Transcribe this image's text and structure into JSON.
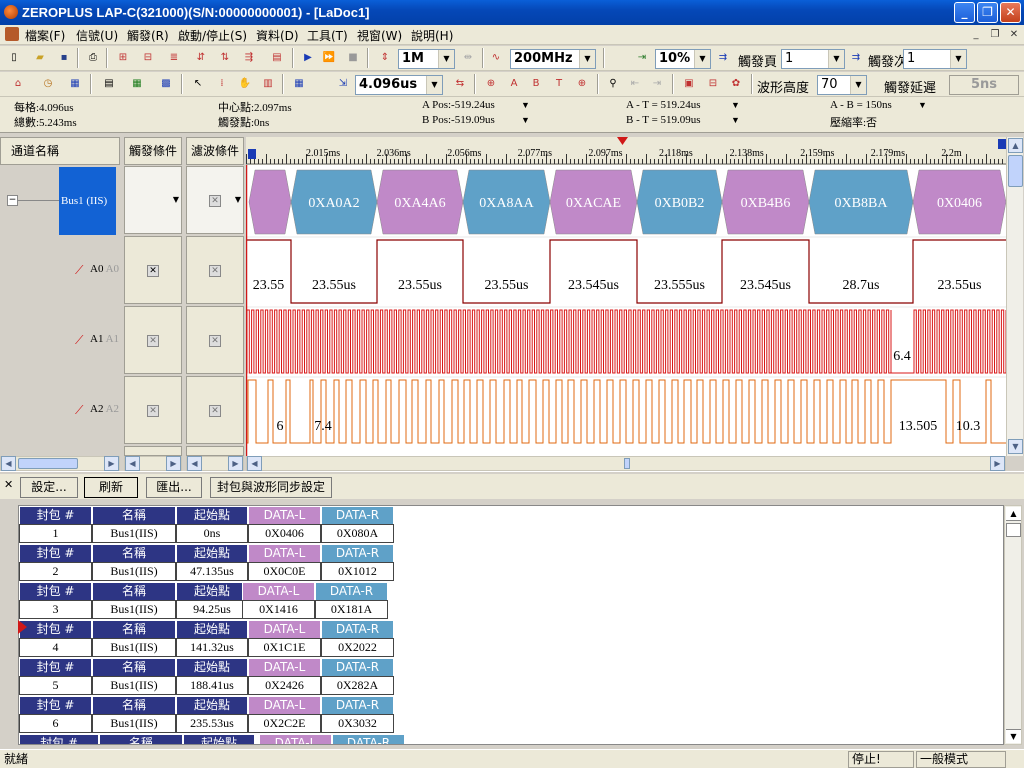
{
  "window": {
    "title": "ZEROPLUS LAP-C(321000)(S/N:00000000001) - [LaDoc1]",
    "min": "_",
    "max": "❐",
    "close": "✕"
  },
  "menu": [
    "檔案(F)",
    "信號(U)",
    "觸發(R)",
    "啟動/停止(S)",
    "資料(D)",
    "工具(T)",
    "視窗(W)",
    "說明(H)"
  ],
  "toolbar1": {
    "memory": "1M",
    "samplerate": "200MHz",
    "trigger_pos": "10%",
    "trigger_page_label": "觸發頁",
    "trigger_page": "1",
    "trigger_count_label": "觸發次數",
    "trigger_count": "1"
  },
  "toolbar2": {
    "time_per_div": "4.096us",
    "wave_height_label": "波形高度",
    "wave_height": "70",
    "trigger_delay_label": "觸發延遲",
    "trigger_delay": "5ns"
  },
  "info": {
    "per_div": "每格:4.096us",
    "total": "總數:5.243ms",
    "center": "中心點:2.097ms",
    "trigger_point": "觸發點:0ns",
    "a_pos": "A Pos:-519.24us",
    "b_pos": "B Pos:-519.09us",
    "a_t": "A - T = 519.24us",
    "b_t": "B - T = 519.09us",
    "a_b": "A - B = 150ns",
    "compress": "壓縮率:否"
  },
  "columns": {
    "channel": "通道名稱",
    "trigger": "觸發條件",
    "filter": "濾波條件"
  },
  "channels": {
    "bus": "Bus1",
    "bus_type": "(IIS)",
    "a0": "A0",
    "a0s": "A0",
    "a1": "A1",
    "a1s": "A1",
    "a2": "A2",
    "a2s": "A2"
  },
  "ruler": [
    "2.015ms",
    "2.036ms",
    "2.056ms",
    "2.077ms",
    "2.097ms",
    "2.118ms",
    "2.138ms",
    "2.159ms",
    "2.179ms",
    "2.2m"
  ],
  "bus_values": [
    "0XA0A2",
    "0XA4A6",
    "0XA8AA",
    "0XACAE",
    "0XB0B2",
    "0XB4B6",
    "0XB8BA",
    "0X0406"
  ],
  "a0_labels": [
    "23.55",
    "23.55us",
    "23.55us",
    "23.55us",
    "23.545us",
    "23.555us",
    "23.545us",
    "28.7us",
    "23.55us"
  ],
  "a1_label": "6.4",
  "a2_labels": [
    "6",
    "7.4",
    "13.505",
    "10.3"
  ],
  "lower_buttons": [
    "設定...",
    "刷新",
    "匯出...",
    "封包與波形同步設定"
  ],
  "packet_headers": {
    "num": "封包 #",
    "name": "名稱",
    "start": "起始點",
    "dl": "DATA-L",
    "dr": "DATA-R"
  },
  "packets": [
    {
      "num": "1",
      "name": "Bus1(IIS)",
      "start": "0ns",
      "dl": "0X0406",
      "dr": "0X080A"
    },
    {
      "num": "2",
      "name": "Bus1(IIS)",
      "start": "47.135us",
      "dl": "0X0C0E",
      "dr": "0X1012"
    },
    {
      "num": "3",
      "name": "Bus1(IIS)",
      "start": "94.25us",
      "dl": "0X1416",
      "dr": "0X181A"
    },
    {
      "num": "4",
      "name": "Bus1(IIS)",
      "start": "141.32us",
      "dl": "0X1C1E",
      "dr": "0X2022"
    },
    {
      "num": "5",
      "name": "Bus1(IIS)",
      "start": "188.41us",
      "dl": "0X2426",
      "dr": "0X282A"
    },
    {
      "num": "6",
      "name": "Bus1(IIS)",
      "start": "235.53us",
      "dl": "0X2C2E",
      "dr": "0X3032"
    }
  ],
  "status": {
    "ready": "就緒",
    "state": "停止!",
    "mode": "一般模式"
  },
  "colors": {
    "bus_pink": "#c089c8",
    "bus_blue": "#5fa1c8",
    "a0": "#8b0000",
    "a1": "#d81818",
    "a2": "#e06a10"
  }
}
